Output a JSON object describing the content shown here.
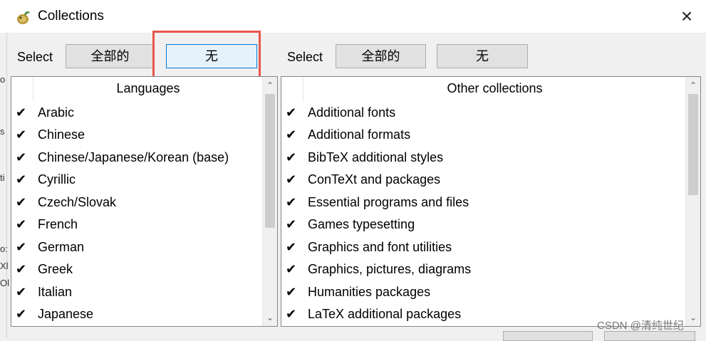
{
  "window": {
    "title": "Collections",
    "close_icon": "×"
  },
  "left_panel": {
    "select_label": "Select",
    "all_label": "全部的",
    "none_label": "无",
    "header": "Languages",
    "items": [
      {
        "checked": true,
        "label": "Arabic"
      },
      {
        "checked": true,
        "label": "Chinese"
      },
      {
        "checked": true,
        "label": "Chinese/Japanese/Korean (base)"
      },
      {
        "checked": true,
        "label": "Cyrillic"
      },
      {
        "checked": true,
        "label": "Czech/Slovak"
      },
      {
        "checked": true,
        "label": "French"
      },
      {
        "checked": true,
        "label": "German"
      },
      {
        "checked": true,
        "label": "Greek"
      },
      {
        "checked": true,
        "label": "Italian"
      },
      {
        "checked": true,
        "label": "Japanese"
      }
    ]
  },
  "right_panel": {
    "select_label": "Select",
    "all_label": "全部的",
    "none_label": "无",
    "header": "Other collections",
    "items": [
      {
        "checked": true,
        "label": "Additional fonts"
      },
      {
        "checked": true,
        "label": "Additional formats"
      },
      {
        "checked": true,
        "label": "BibTeX additional styles"
      },
      {
        "checked": true,
        "label": "ConTeXt and packages"
      },
      {
        "checked": true,
        "label": "Essential programs and files"
      },
      {
        "checked": true,
        "label": "Games typesetting"
      },
      {
        "checked": true,
        "label": "Graphics and font utilities"
      },
      {
        "checked": true,
        "label": "Graphics, pictures, diagrams"
      },
      {
        "checked": true,
        "label": "Humanities packages"
      },
      {
        "checked": true,
        "label": "LaTeX additional packages"
      }
    ]
  },
  "glyphs": {
    "check": "✔",
    "scroll_up": "⌃",
    "scroll_down": "⌄"
  },
  "left_edge_fragments": [
    "o",
    "s",
    "ti",
    "o:",
    "Xl",
    "Ol"
  ],
  "watermark": "CSDN @清纯世纪",
  "colors": {
    "highlight_border": "#e8554a",
    "active_button_border": "#0078d7",
    "active_button_fill": "#e5f1fb"
  }
}
